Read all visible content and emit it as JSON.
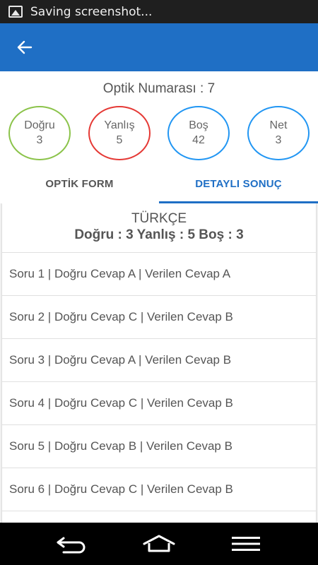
{
  "status_bar": {
    "text": "Saving screenshot..."
  },
  "header": {
    "optik_label": "Optik Numarası : 7"
  },
  "stats": [
    {
      "label": "Doğru",
      "value": "3",
      "color": "#8bc34a"
    },
    {
      "label": "Yanlış",
      "value": "5",
      "color": "#e53935"
    },
    {
      "label": "Boş",
      "value": "42",
      "color": "#2196f3"
    },
    {
      "label": "Net",
      "value": "3",
      "color": "#2196f3"
    }
  ],
  "tabs": [
    {
      "label": "OPTİK FORM",
      "active": false
    },
    {
      "label": "DETAYLI SONUÇ",
      "active": true
    }
  ],
  "section": {
    "subject": "TÜRKÇE",
    "counts": "Doğru : 3 Yanlış : 5 Boş : 3"
  },
  "rows": [
    "Soru 1 | Doğru Cevap A | Verilen Cevap A",
    "Soru 2 | Doğru Cevap C | Verilen Cevap B",
    "Soru 3 | Doğru Cevap A | Verilen Cevap B",
    "Soru 4 | Doğru Cevap C | Verilen Cevap B",
    "Soru 5 | Doğru Cevap B | Verilen Cevap B",
    "Soru 6 | Doğru Cevap C | Verilen Cevap B"
  ],
  "colors": {
    "primary": "#1f6fc5",
    "status_bar": "#1f1f1f",
    "nav_bar": "#000000"
  },
  "icons": {
    "back": "arrow-left-icon",
    "nav_back": "back-icon",
    "nav_home": "home-icon",
    "nav_menu": "menu-icon"
  }
}
